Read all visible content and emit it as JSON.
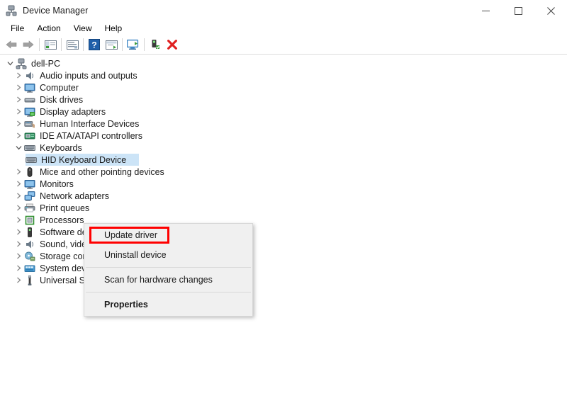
{
  "window": {
    "title": "Device Manager",
    "icon": "device-manager-icon",
    "controls": {
      "minimize": "─",
      "maximize": "□",
      "close": "✕"
    }
  },
  "menubar": {
    "items": [
      {
        "label": "File",
        "name": "menu-file"
      },
      {
        "label": "Action",
        "name": "menu-action"
      },
      {
        "label": "View",
        "name": "menu-view"
      },
      {
        "label": "Help",
        "name": "menu-help"
      }
    ]
  },
  "toolbar": {
    "buttons": [
      {
        "name": "back-icon",
        "glyph": "⬅",
        "color": "#8f8f8f",
        "tip": "Back"
      },
      {
        "name": "forward-icon",
        "glyph": "➡",
        "color": "#8f8f8f",
        "tip": "Forward"
      },
      {
        "name": "separator-1",
        "glyph": "",
        "color": "",
        "tip": ""
      },
      {
        "name": "show-hide-console-tree-icon",
        "glyph": "",
        "color": "#4a7ebb",
        "tip": "Show/Hide Console Tree"
      },
      {
        "name": "separator-2",
        "glyph": "",
        "color": "",
        "tip": ""
      },
      {
        "name": "properties-icon",
        "glyph": "",
        "color": "#5b8dc8",
        "tip": "Properties"
      },
      {
        "name": "separator-3",
        "glyph": "",
        "color": "",
        "tip": ""
      },
      {
        "name": "help-icon",
        "glyph": "?",
        "color": "#1f5fa9",
        "tip": "Help"
      },
      {
        "name": "update-driver-icon",
        "glyph": "",
        "color": "#4a7ebb",
        "tip": "Update Driver"
      },
      {
        "name": "separator-4",
        "glyph": "",
        "color": "",
        "tip": ""
      },
      {
        "name": "scan-hardware-changes-icon",
        "glyph": "",
        "color": "#3f86c4",
        "tip": "Scan for hardware changes"
      },
      {
        "name": "separator-5",
        "glyph": "",
        "color": "",
        "tip": ""
      },
      {
        "name": "enable-device-icon",
        "glyph": "",
        "color": "#3b8f3b",
        "tip": "Enable device"
      },
      {
        "name": "uninstall-device-icon",
        "glyph": "✘",
        "color": "#e02020",
        "tip": "Uninstall device"
      }
    ]
  },
  "tree": {
    "items": [
      {
        "label": "dell-PC",
        "indent": 0,
        "state": "expanded",
        "icon": "computer-root-icon",
        "selected": false
      },
      {
        "label": "Audio inputs and outputs",
        "indent": 1,
        "state": "collapsed",
        "icon": "speaker-icon",
        "selected": false
      },
      {
        "label": "Computer",
        "indent": 1,
        "state": "collapsed",
        "icon": "monitor-icon",
        "selected": false
      },
      {
        "label": "Disk drives",
        "indent": 1,
        "state": "collapsed",
        "icon": "disk-drive-icon",
        "selected": false
      },
      {
        "label": "Display adapters",
        "indent": 1,
        "state": "collapsed",
        "icon": "display-adapter-icon",
        "selected": false
      },
      {
        "label": "Human Interface Devices",
        "indent": 1,
        "state": "collapsed",
        "icon": "hid-icon",
        "selected": false
      },
      {
        "label": "IDE ATA/ATAPI controllers",
        "indent": 1,
        "state": "collapsed",
        "icon": "ide-controller-icon",
        "selected": false
      },
      {
        "label": "Keyboards",
        "indent": 1,
        "state": "expanded",
        "icon": "keyboard-icon",
        "selected": false
      },
      {
        "label": "HID Keyboard Device",
        "indent": 2,
        "state": "leaf",
        "icon": "keyboard-icon",
        "selected": true
      },
      {
        "label": "Mice and other pointing devices",
        "indent": 1,
        "state": "collapsed",
        "icon": "mouse-icon",
        "selected": false
      },
      {
        "label": "Monitors",
        "indent": 1,
        "state": "collapsed",
        "icon": "monitor-icon",
        "selected": false
      },
      {
        "label": "Network adapters",
        "indent": 1,
        "state": "collapsed",
        "icon": "network-adapter-icon",
        "selected": false
      },
      {
        "label": "Print queues",
        "indent": 1,
        "state": "collapsed",
        "icon": "printer-icon",
        "selected": false
      },
      {
        "label": "Processors",
        "indent": 1,
        "state": "collapsed",
        "icon": "processor-icon",
        "selected": false
      },
      {
        "label": "Software devices",
        "indent": 1,
        "state": "collapsed",
        "icon": "software-device-icon",
        "selected": false
      },
      {
        "label": "Sound, video and game controllers",
        "indent": 1,
        "state": "collapsed",
        "icon": "speaker-icon",
        "selected": false
      },
      {
        "label": "Storage controllers",
        "indent": 1,
        "state": "collapsed",
        "icon": "storage-controller-icon",
        "selected": false
      },
      {
        "label": "System devices",
        "indent": 1,
        "state": "collapsed",
        "icon": "system-device-icon",
        "selected": false
      },
      {
        "label": "Universal Serial Bus controllers",
        "indent": 1,
        "state": "collapsed",
        "icon": "usb-icon",
        "selected": false
      }
    ],
    "chevron_collapsed": "›",
    "chevron_expanded": "⌄"
  },
  "context_menu": {
    "items": [
      {
        "label": "Update driver",
        "bold": false,
        "highlighted": true,
        "name": "ctx-update-driver"
      },
      {
        "label": "Uninstall device",
        "bold": false,
        "highlighted": false,
        "name": "ctx-uninstall-device"
      },
      {
        "separator": true
      },
      {
        "label": "Scan for hardware changes",
        "bold": false,
        "highlighted": false,
        "name": "ctx-scan-hardware-changes"
      },
      {
        "separator": true
      },
      {
        "label": "Properties",
        "bold": true,
        "highlighted": false,
        "name": "ctx-properties"
      }
    ],
    "highlight_color": "#ff0000"
  }
}
